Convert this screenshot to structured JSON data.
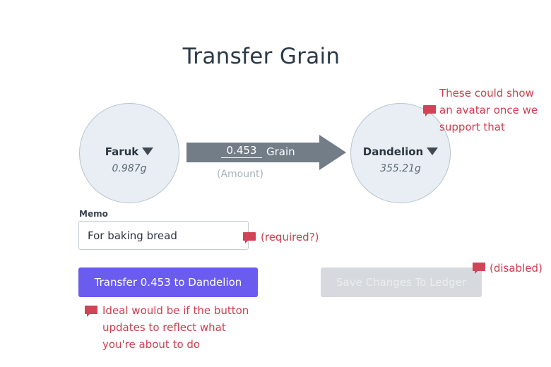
{
  "page": {
    "title": "Transfer Grain"
  },
  "transfer": {
    "from": {
      "name": "Faruk",
      "balance": "0.987g"
    },
    "to": {
      "name": "Dandelion",
      "balance": "355.21g"
    },
    "amount_value": "0.453",
    "amount_unit": "Grain",
    "amount_hint": "(Amount)",
    "arrow_color": "#727d88"
  },
  "memo": {
    "label": "Memo",
    "value": "For baking bread"
  },
  "actions": {
    "transfer_label": "Transfer 0.453 to Dandelion",
    "save_label": "Save Changes To Ledger",
    "primary_color": "#6b5cf0",
    "disabled_color": "#d6dade"
  },
  "annotations": {
    "avatar_note": [
      "These could show",
      "an avatar once we",
      "support that"
    ],
    "memo_note": "(required?)",
    "save_note": "(disabled)",
    "button_note": [
      "Ideal would be if the button",
      "updates to reflect what",
      "you're about to do"
    ],
    "note_color": "#cf3d4e",
    "icon": "comment-icon"
  }
}
